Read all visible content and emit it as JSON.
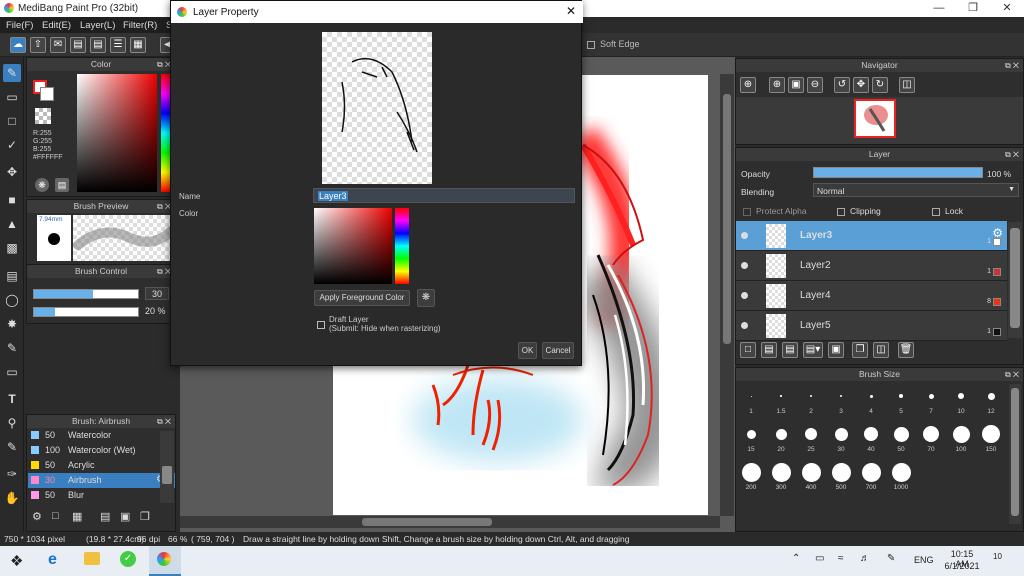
{
  "app": {
    "title": "MediBang Paint Pro (32bit)"
  },
  "menu": [
    "File(F)",
    "Edit(E)",
    "Layer(L)",
    "Filter(R)",
    "S"
  ],
  "toolbar": {
    "soft_edge": "Soft Edge"
  },
  "color_panel": {
    "title": "Color",
    "r": "R:255",
    "g": "G:255",
    "b": "B:255",
    "hex": "#FFFFFF"
  },
  "brush_preview": {
    "title": "Brush Preview",
    "size": "7.94mm"
  },
  "brush_control": {
    "title": "Brush Control",
    "size_value": "30",
    "size_fraction": 0.57,
    "opacity_value": "20 %",
    "opacity_fraction": 0.2
  },
  "brush_list": {
    "title": "Brush: Airbrush",
    "items": [
      {
        "size": "50",
        "name": "Watercolor",
        "color": "#88ccff"
      },
      {
        "size": "100",
        "name": "Watercolor (Wet)",
        "color": "#88ccff"
      },
      {
        "size": "50",
        "name": "Acrylic",
        "color": "#ffdd00"
      },
      {
        "size": "30",
        "name": "Airbrush",
        "color": "#ff88cc",
        "selected": true
      },
      {
        "size": "50",
        "name": "Blur",
        "color": "#ff99ee"
      }
    ]
  },
  "dialog": {
    "title": "Layer Property",
    "name_label": "Name",
    "name_value": "Layer3",
    "color_label": "Color",
    "apply_fg": "Apply Foreground Color",
    "draft_label": "Draft Layer",
    "draft_sub": "(Submit: Hide when rasterizing)",
    "ok": "OK",
    "cancel": "Cancel"
  },
  "navigator": {
    "title": "Navigator"
  },
  "layer_panel": {
    "title": "Layer",
    "opacity_label": "Opacity",
    "opacity_value": "100 %",
    "opacity_fraction": 1.0,
    "blending_label": "Blending",
    "blending_value": "Normal",
    "protect_alpha": "Protect Alpha",
    "clipping": "Clipping",
    "lock": "Lock",
    "layers": [
      {
        "name": "Layer3",
        "count": "1",
        "swatch": "#ffffff",
        "selected": true
      },
      {
        "name": "Layer2",
        "count": "1",
        "swatch": "#cc3333"
      },
      {
        "name": "Layer4",
        "count": "8",
        "swatch": "#ee3311"
      },
      {
        "name": "Layer5",
        "count": "1",
        "swatch": "#111111"
      }
    ]
  },
  "brush_size": {
    "title": "Brush Size",
    "sizes": [
      "1",
      "1.5",
      "2",
      "3",
      "4",
      "5",
      "7",
      "10",
      "12",
      "15",
      "20",
      "25",
      "30",
      "40",
      "50",
      "70",
      "100",
      "150",
      "200",
      "300",
      "400",
      "500",
      "700",
      "1000"
    ]
  },
  "status": {
    "dims": "750 * 1034 pixel",
    "physical": "(19.8 * 27.4cm)",
    "dpi": "96 dpi",
    "zoom": "66 %",
    "coords": "( 759, 704 )",
    "hint": "Draw a straight line by holding down Shift, Change a brush size by holding down Ctrl, Alt, and dragging"
  },
  "taskbar": {
    "time": "10:15 AM",
    "date": "6/1/2021",
    "lang": "ENG",
    "notif": "10"
  }
}
